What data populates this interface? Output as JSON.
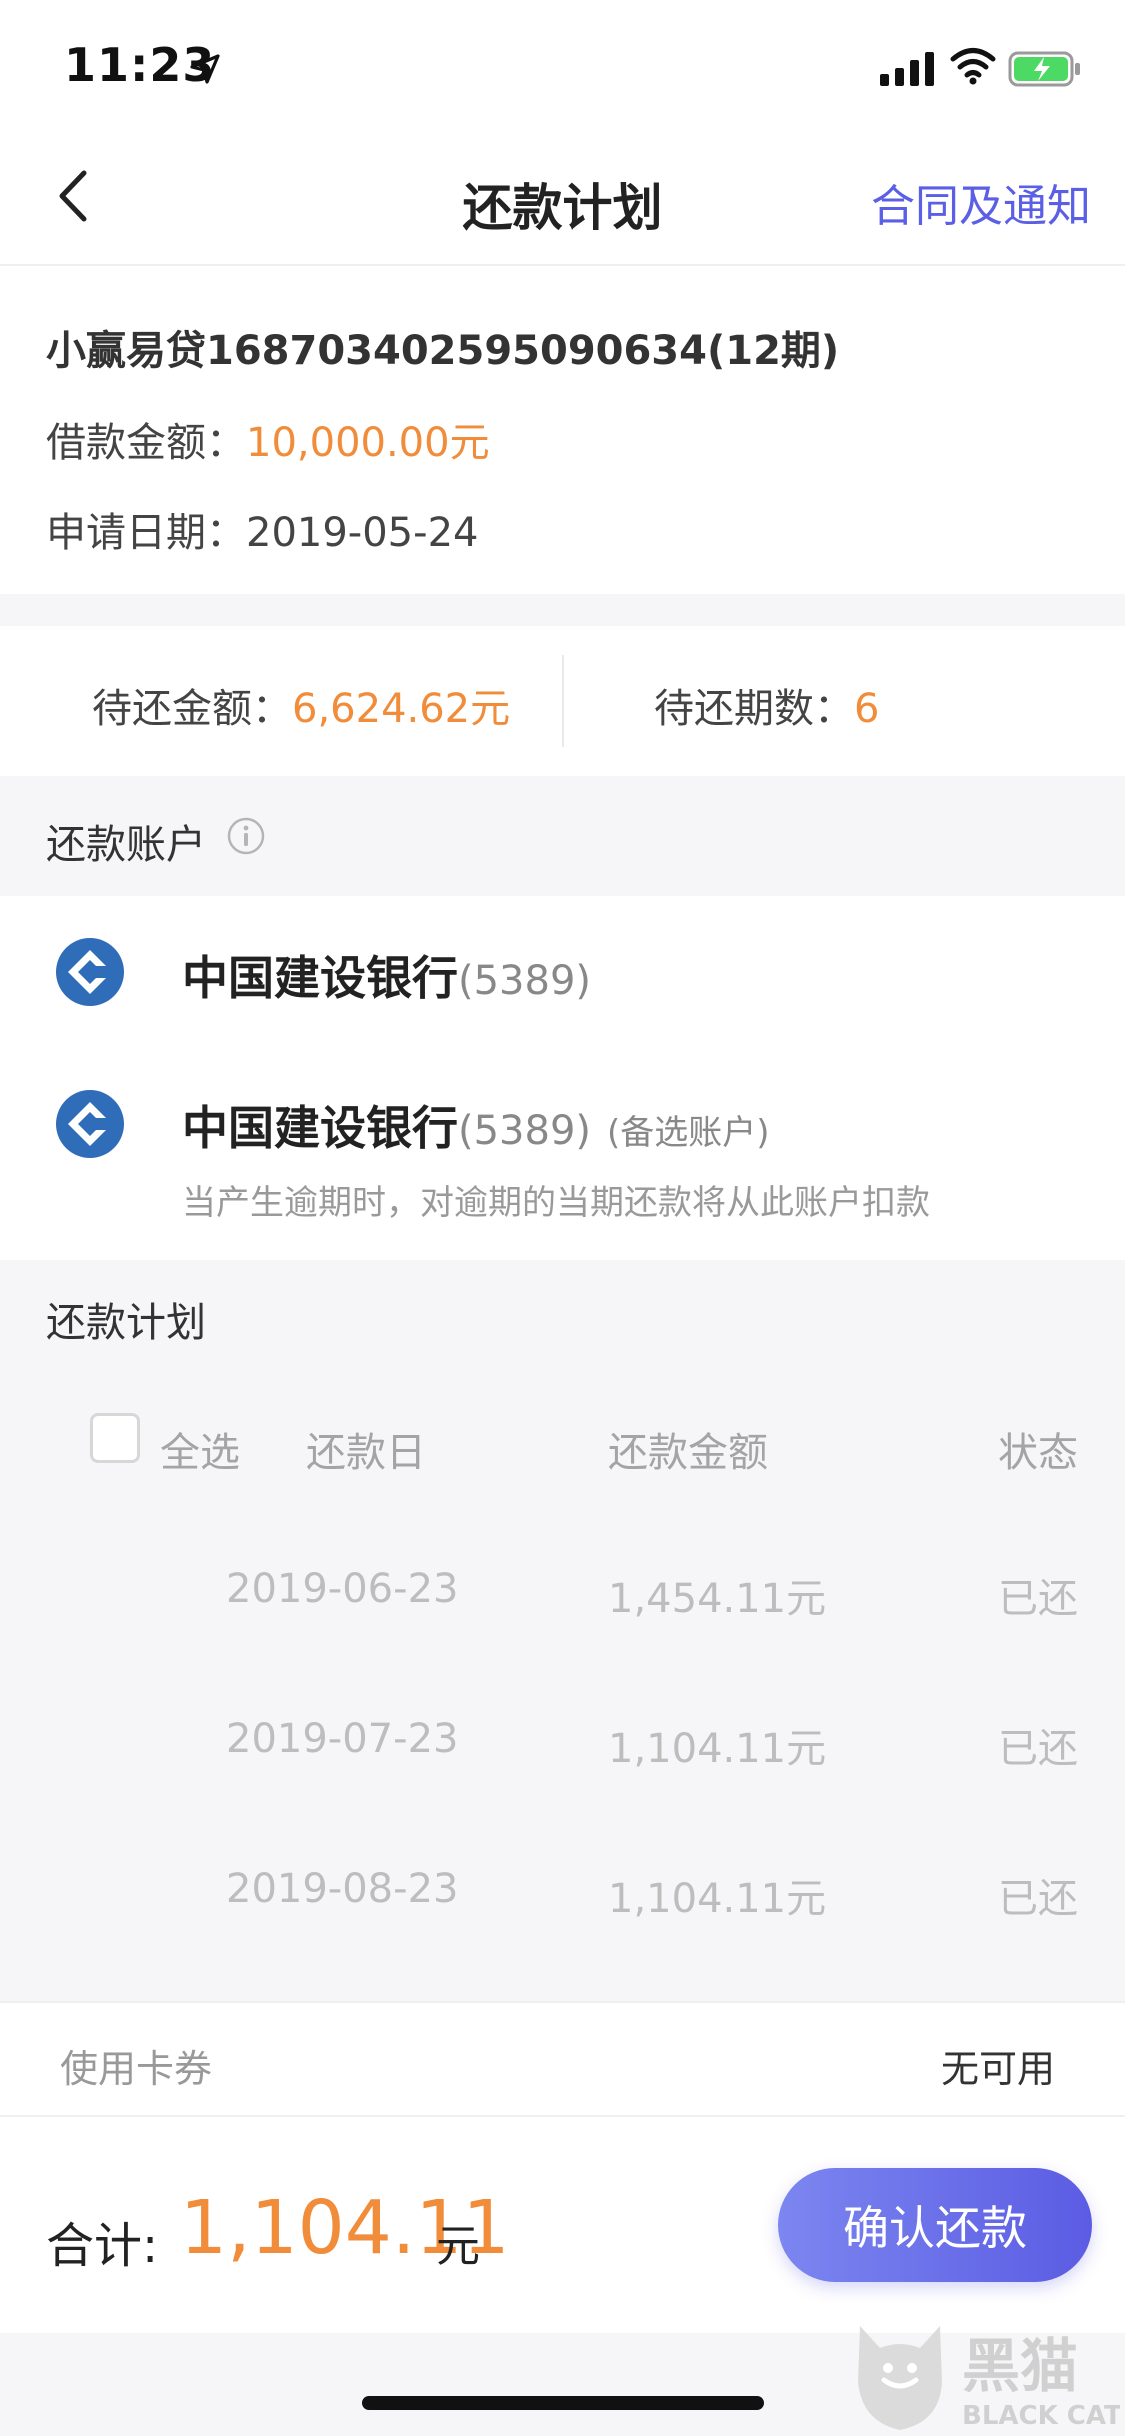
{
  "status_bar": {
    "time": "11:23"
  },
  "nav": {
    "title": "还款计划",
    "right_link": "合同及通知"
  },
  "loan": {
    "title": "小赢易贷168703402595090634(12期)",
    "amount_label": "借款金额：",
    "amount_value": "10,000.00元",
    "date_label": "申请日期：",
    "date_value": "2019-05-24"
  },
  "summary": {
    "pending_amount_label": "待还金额：",
    "pending_amount_value": "6,624.62元",
    "pending_periods_label": "待还期数：",
    "pending_periods_value": "6"
  },
  "account_section": {
    "label": "还款账户",
    "primary": {
      "bank": "中国建设银行",
      "card": "(5389)"
    },
    "backup": {
      "bank": "中国建设银行",
      "card": "(5389)",
      "tag": "(备选账户)",
      "hint": "当产生逾期时，对逾期的当期还款将从此账户扣款"
    }
  },
  "plan_section": {
    "label": "还款计划",
    "select_all": "全选",
    "headers": {
      "date": "还款日",
      "amount": "还款金额",
      "status": "状态"
    },
    "rows": [
      {
        "date": "2019-06-23",
        "amount": "1,454.11元",
        "status": "已还"
      },
      {
        "date": "2019-07-23",
        "amount": "1,104.11元",
        "status": "已还"
      },
      {
        "date": "2019-08-23",
        "amount": "1,104.11元",
        "status": "已还"
      }
    ]
  },
  "coupon": {
    "label": "使用卡券",
    "value": "无可用"
  },
  "footer": {
    "total_label": "合计:",
    "total_amount": "1,104.11",
    "total_unit": "元",
    "confirm": "确认还款"
  },
  "watermark": {
    "cn": "黑猫",
    "en": "BLACK CAT"
  },
  "colors": {
    "accent_orange": "#f08c3a",
    "accent_purple": "#5b5fe6",
    "bank_blue": "#2f6db8"
  }
}
